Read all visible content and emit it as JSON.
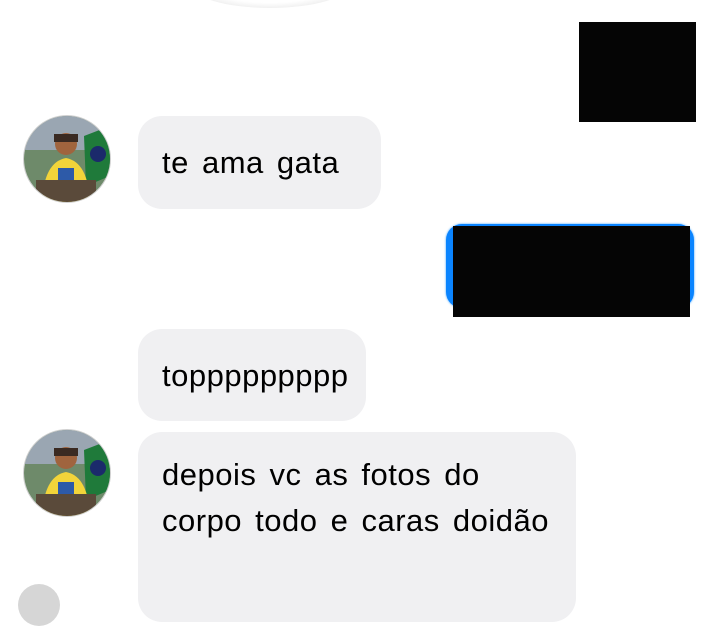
{
  "conversation": {
    "messages": [
      {
        "sender": "contact",
        "text": "te ama gata"
      },
      {
        "sender": "contact",
        "text": "toppppppppp"
      },
      {
        "sender": "contact",
        "text": "depois vc as fotos do corpo todo e caras doidão"
      }
    ]
  },
  "icons": {
    "avatar": "contact-avatar-photo",
    "seen": "seen-indicator-icon"
  },
  "colors": {
    "incoming_bubble": "#f0f0f2",
    "outgoing_bubble": "#0a84ff",
    "redaction": "#050505"
  }
}
